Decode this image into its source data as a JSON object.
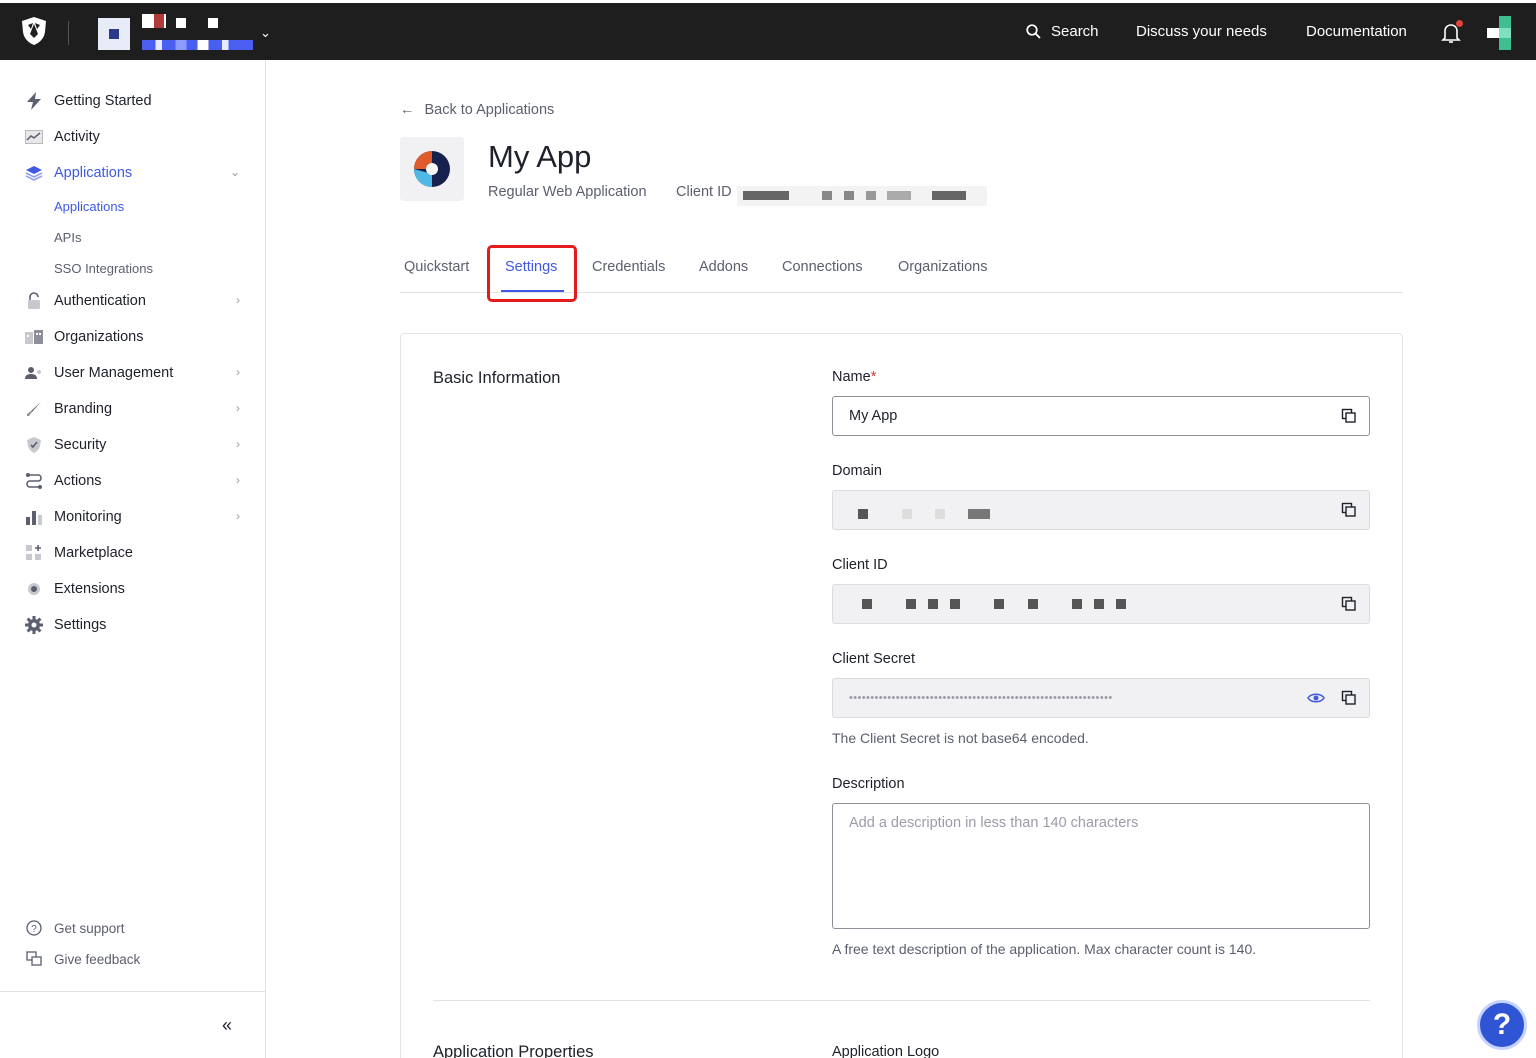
{
  "topbar": {
    "search_label": "Search",
    "discuss_label": "Discuss your needs",
    "docs_label": "Documentation"
  },
  "sidebar": {
    "items": [
      {
        "label": "Getting Started"
      },
      {
        "label": "Activity"
      },
      {
        "label": "Applications"
      },
      {
        "label": "Authentication"
      },
      {
        "label": "Organizations"
      },
      {
        "label": "User Management"
      },
      {
        "label": "Branding"
      },
      {
        "label": "Security"
      },
      {
        "label": "Actions"
      },
      {
        "label": "Monitoring"
      },
      {
        "label": "Marketplace"
      },
      {
        "label": "Extensions"
      },
      {
        "label": "Settings"
      }
    ],
    "sub_items": [
      {
        "label": "Applications"
      },
      {
        "label": "APIs"
      },
      {
        "label": "SSO Integrations"
      }
    ],
    "footer": {
      "support": "Get support",
      "feedback": "Give feedback"
    }
  },
  "header": {
    "back_label": "Back to Applications",
    "app_name": "My App",
    "app_type": "Regular Web Application",
    "client_id_label": "Client ID"
  },
  "tabs": [
    {
      "label": "Quickstart"
    },
    {
      "label": "Settings"
    },
    {
      "label": "Credentials"
    },
    {
      "label": "Addons"
    },
    {
      "label": "Connections"
    },
    {
      "label": "Organizations"
    }
  ],
  "form": {
    "section_title": "Basic Information",
    "name_label": "Name",
    "name_required": "*",
    "name_value": "My App",
    "domain_label": "Domain",
    "client_id_label": "Client ID",
    "client_secret_label": "Client Secret",
    "client_secret_value": "••••••••••••••••••••••••••••••••••••••••••••••••••••••••••••••",
    "client_secret_help": "The Client Secret is not base64 encoded.",
    "description_label": "Description",
    "description_placeholder": "Add a description in less than 140 characters",
    "description_help": "A free text description of the application. Max character count is 140.",
    "next_section_title": "Application Properties",
    "next_right_label": "Application Logo"
  },
  "help_fab": "?",
  "colors": {
    "accent": "#3f59e4",
    "topbar": "#1e1e1e",
    "highlight": "#e31b1b"
  }
}
